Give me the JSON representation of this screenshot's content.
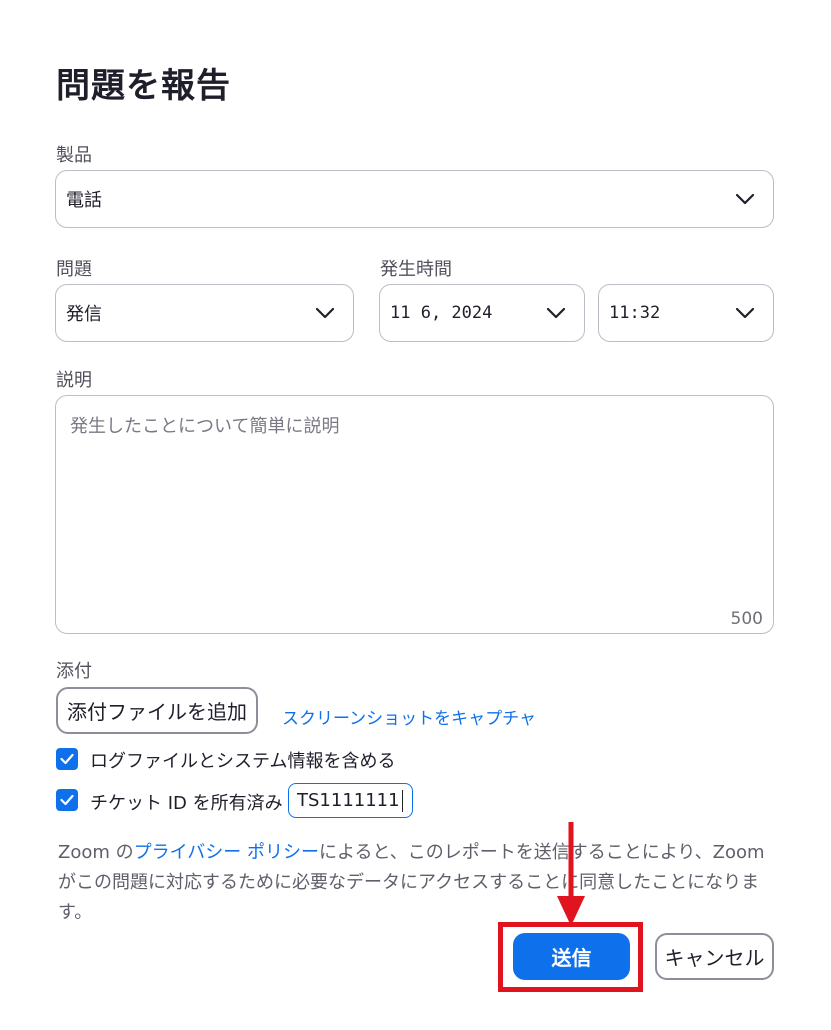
{
  "dialog": {
    "title": "問題を報告"
  },
  "product": {
    "label": "製品",
    "value": "電話"
  },
  "issue": {
    "label": "問題",
    "value": "発信"
  },
  "occurred": {
    "label": "発生時間",
    "date": "11 6, 2024",
    "time": "11:32"
  },
  "description": {
    "label": "説明",
    "placeholder": "発生したことについて簡単に説明",
    "char_count": "500"
  },
  "attachment": {
    "label": "添付",
    "add_button": "添付ファイルを追加",
    "screenshot_link": "スクリーンショットをキャプチャ"
  },
  "options": {
    "include_logs": {
      "label": "ログファイルとシステム情報を含める",
      "checked": true
    },
    "ticket": {
      "label": "チケット ID を所有済み",
      "checked": true,
      "value": "TS1111111"
    }
  },
  "notice": {
    "prefix": "Zoom の",
    "link": "プライバシー ポリシー",
    "suffix": "によると、このレポートを送信することにより、Zoom がこの問題に対応するために必要なデータにアクセスすることに同意したことになります。"
  },
  "actions": {
    "submit": "送信",
    "cancel": "キャンセル"
  },
  "colors": {
    "accent": "#0e71eb",
    "annotation": "#e0141e"
  }
}
